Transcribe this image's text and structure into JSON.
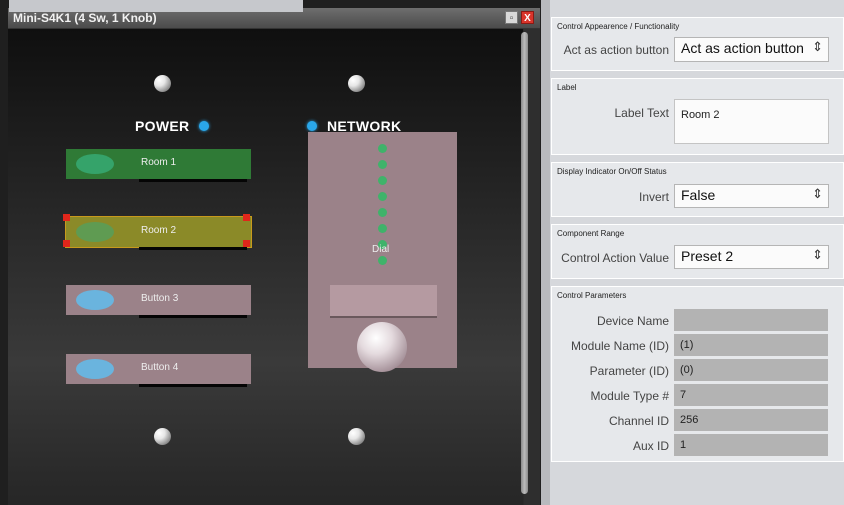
{
  "window": {
    "title": "Mini-S4K1 (4 Sw, 1 Knob)",
    "restore_label": "▫",
    "close_label": "X"
  },
  "panel": {
    "power_label": "POWER",
    "network_label": "NETWORK",
    "buttons": [
      {
        "label": "Room 1"
      },
      {
        "label": "Room 2"
      },
      {
        "label": "Button 3"
      },
      {
        "label": "Button 4"
      }
    ],
    "dial_label": "Dial",
    "led_color": "#2aa7ea"
  },
  "properties": {
    "control_appearance": {
      "title": "Control Appearence / Functionality",
      "label": "Act as action button",
      "value": "Act as action button"
    },
    "label_section": {
      "title": "Label",
      "label": "Label Text",
      "value": "Room 2"
    },
    "display_indicator": {
      "title": "Display Indicator On/Off Status",
      "label": "Invert",
      "value": "False"
    },
    "component_range": {
      "title": "Component Range",
      "label": "Control Action Value",
      "value": "Preset 2"
    },
    "control_parameters": {
      "title": "Control Parameters",
      "rows": [
        {
          "label": "Device Name",
          "value": ""
        },
        {
          "label": "Module Name (ID)",
          "value": "(1)"
        },
        {
          "label": "Parameter (ID)",
          "value": "(0)"
        },
        {
          "label": "Module Type #",
          "value": "7"
        },
        {
          "label": "Channel ID",
          "value": "256"
        },
        {
          "label": "Aux ID",
          "value": "1"
        }
      ]
    }
  }
}
